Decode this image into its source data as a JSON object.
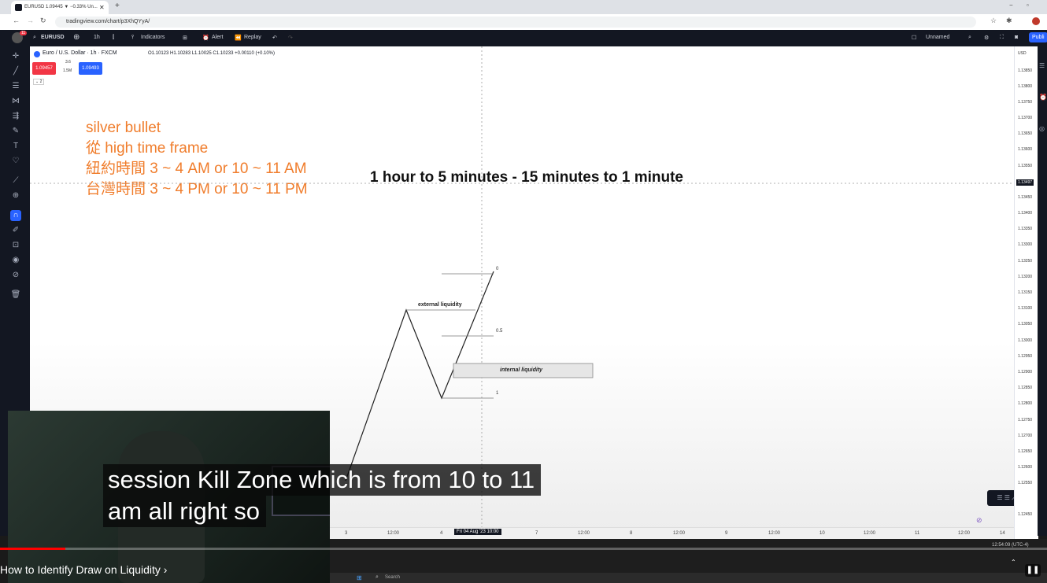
{
  "browser": {
    "tab_title": "EURUSD 1.09445 ▼ −0.33% Un...",
    "url": "tradingview.com/chart/p3XhQYyA/"
  },
  "toolbar": {
    "symbol": "EURUSD",
    "interval": "1h",
    "indicators": "Indicators",
    "alert": "Alert",
    "replay": "Replay",
    "layout_name": "Unnamed",
    "publish": "Publi",
    "notif_badge": "11"
  },
  "legend": {
    "instrument": "Euro / U.S. Dollar · 1h · FXCM",
    "ohlc": "O1.10123  H1.10283  L1.10025  C1.10233  +0.00110 (+0.10%)",
    "sell_price": "1.09457",
    "spread": "3.6",
    "volume": "1.5M",
    "buy_price": "1.09493",
    "collapse": "⌄ 2"
  },
  "annotations": {
    "orange_lines": [
      "silver bullet",
      "從 high time frame",
      "紐約時間 3 ~ 4 AM or 10 ~ 11 AM",
      "台灣時間 3 ~ 4 PM or 10 ~ 11 PM"
    ],
    "headline": "1 hour to 5 minutes - 15 minutes to 1 minute",
    "external_liquidity": "external liquidity",
    "internal_liquidity": "internal liquidity",
    "fib_0": "0",
    "fib_05": "0.5",
    "fib_1": "1"
  },
  "price_axis": {
    "currency": "USD",
    "labels": [
      "1.13850",
      "1.13800",
      "1.13750",
      "1.13700",
      "1.13650",
      "1.13600",
      "1.13550",
      "1.13497",
      "1.13450",
      "1.13400",
      "1.13350",
      "1.13300",
      "1.13250",
      "1.13200",
      "1.13150",
      "1.13100",
      "1.13050",
      "1.13000",
      "1.12950",
      "1.12900",
      "1.12850",
      "1.12800",
      "1.12750",
      "1.12700",
      "1.12650",
      "1.12600",
      "1.12550",
      "1.12450"
    ],
    "current_price": "1.13497"
  },
  "time_axis": {
    "labels": [
      "3",
      "12:00",
      "4",
      "Fri 04 Aug '23  10:00",
      "7",
      "12:00",
      "8",
      "12:00",
      "9",
      "12:00",
      "10",
      "12:00",
      "11",
      "12:00",
      "14"
    ],
    "clock": "12:54:09 (UTC-4)"
  },
  "video": {
    "caption_line1": "session Kill Zone which is from 10 to 11",
    "caption_line2": "am all right so",
    "title": "How to Identify Draw on Liquidity"
  },
  "taskbar": {
    "search": "Search"
  },
  "colors": {
    "orange_text": "#f07d2c",
    "tv_dark": "#131722",
    "tv_blue": "#2962ff",
    "sell_red": "#f23645"
  }
}
